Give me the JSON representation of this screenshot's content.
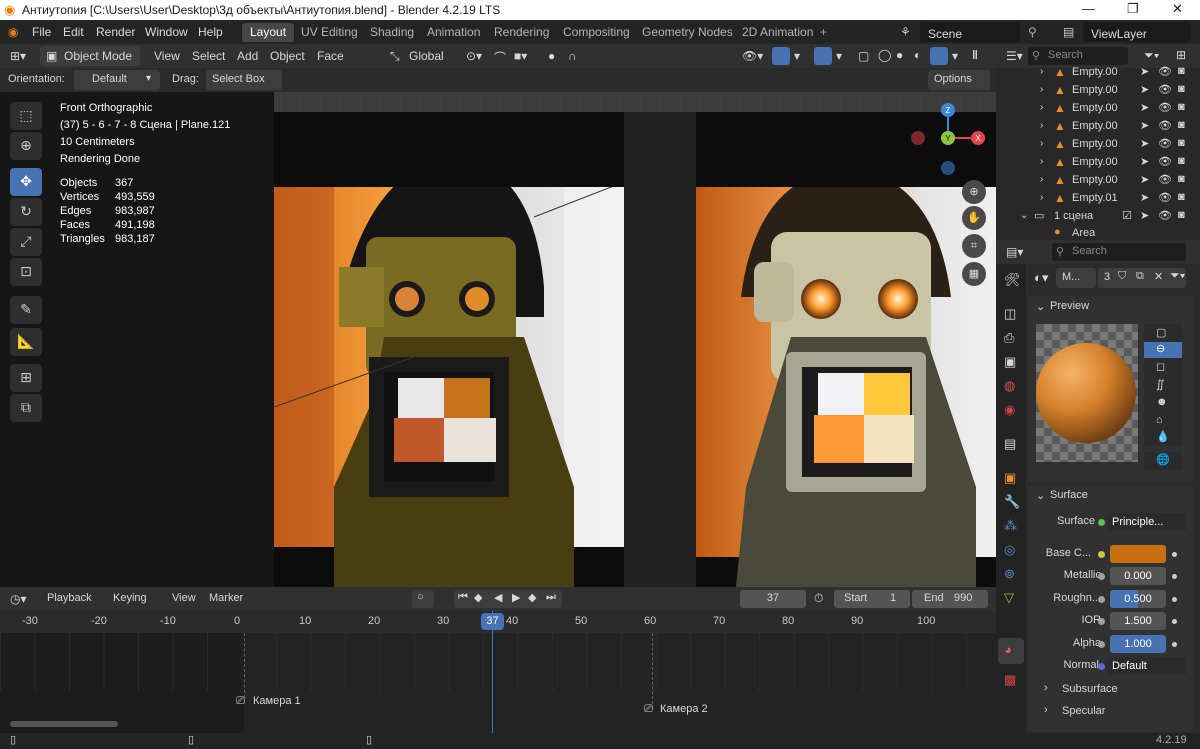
{
  "window": {
    "title": "Антиутопия [C:\\Users\\User\\Desktop\\3д объекты\\Антиутопия.blend] - Blender 4.2.19 LTS"
  },
  "menu": [
    "File",
    "Edit",
    "Render",
    "Window",
    "Help"
  ],
  "workspaces": [
    "Layout",
    "UV Editing",
    "Shading",
    "Animation",
    "Rendering",
    "Compositing",
    "Geometry Nodes",
    "2D Animation"
  ],
  "scene": {
    "name": "Scene",
    "view_layer": "ViewLayer"
  },
  "viewport_header": {
    "mode": "Object Mode",
    "menus": [
      "View",
      "Select",
      "Add",
      "Object",
      "Face"
    ],
    "transform": "Global"
  },
  "tool_settings": {
    "orientation_label": "Orientation:",
    "orientation_value": "Default",
    "drag_label": "Drag:",
    "drag_value": "Select Box",
    "options": "Options"
  },
  "overlay": {
    "view": "Front Orthographic",
    "collection": "(37) 5 - 6 - 7 - 8 Сцена | Plane.121",
    "scale": "10 Centimeters",
    "status": "Rendering Done",
    "stats": [
      {
        "label": "Objects",
        "value": "367"
      },
      {
        "label": "Vertices",
        "value": "493,559"
      },
      {
        "label": "Edges",
        "value": "983,987"
      },
      {
        "label": "Faces",
        "value": "491,198"
      },
      {
        "label": "Triangles",
        "value": "983,187"
      }
    ]
  },
  "gizmo": {
    "z": "Z",
    "y": "Y",
    "x": "X"
  },
  "outliner": {
    "search_placeholder": "Search",
    "rows": [
      "Empty.00",
      "Empty.00",
      "Empty.00",
      "Empty.00",
      "Empty.00",
      "Empty.00",
      "Empty.00",
      "Empty.01"
    ],
    "collection": "1 сцена",
    "last": "Area"
  },
  "properties": {
    "search_placeholder": "Search",
    "material_name": "M...",
    "users": "3",
    "preview_label": "Preview",
    "surface_panel": "Surface",
    "rows": [
      {
        "label": "Surface",
        "value": "Principle..."
      },
      {
        "label": "Base C...",
        "value": ""
      },
      {
        "label": "Metallic",
        "value": "0.000"
      },
      {
        "label": "Roughn...",
        "value": "0.500"
      },
      {
        "label": "IOR",
        "value": "1.500"
      },
      {
        "label": "Alpha",
        "value": "1.000"
      },
      {
        "label": "Normal",
        "value": "Default"
      }
    ],
    "subpanels": [
      "Subsurface",
      "Specular"
    ],
    "base_color": "#c87010",
    "roughness_fraction": 0.5
  },
  "timeline": {
    "menus": [
      "Playback",
      "Keying",
      "View",
      "Marker"
    ],
    "current_frame": "37",
    "start_label": "Start",
    "start": "1",
    "end_label": "End",
    "end": "990",
    "ticks": [
      "-30",
      "-20",
      "-10",
      "0",
      "10",
      "20",
      "30",
      "40",
      "50",
      "60",
      "70",
      "80",
      "90",
      "100"
    ],
    "markers": [
      "Камера 1",
      "Камера 2"
    ]
  },
  "version": "4.2.19",
  "colors": {
    "accent": "#4772b3",
    "axis_x": "#e0474b",
    "axis_y": "#8cc63f",
    "axis_z": "#3d85d8"
  }
}
